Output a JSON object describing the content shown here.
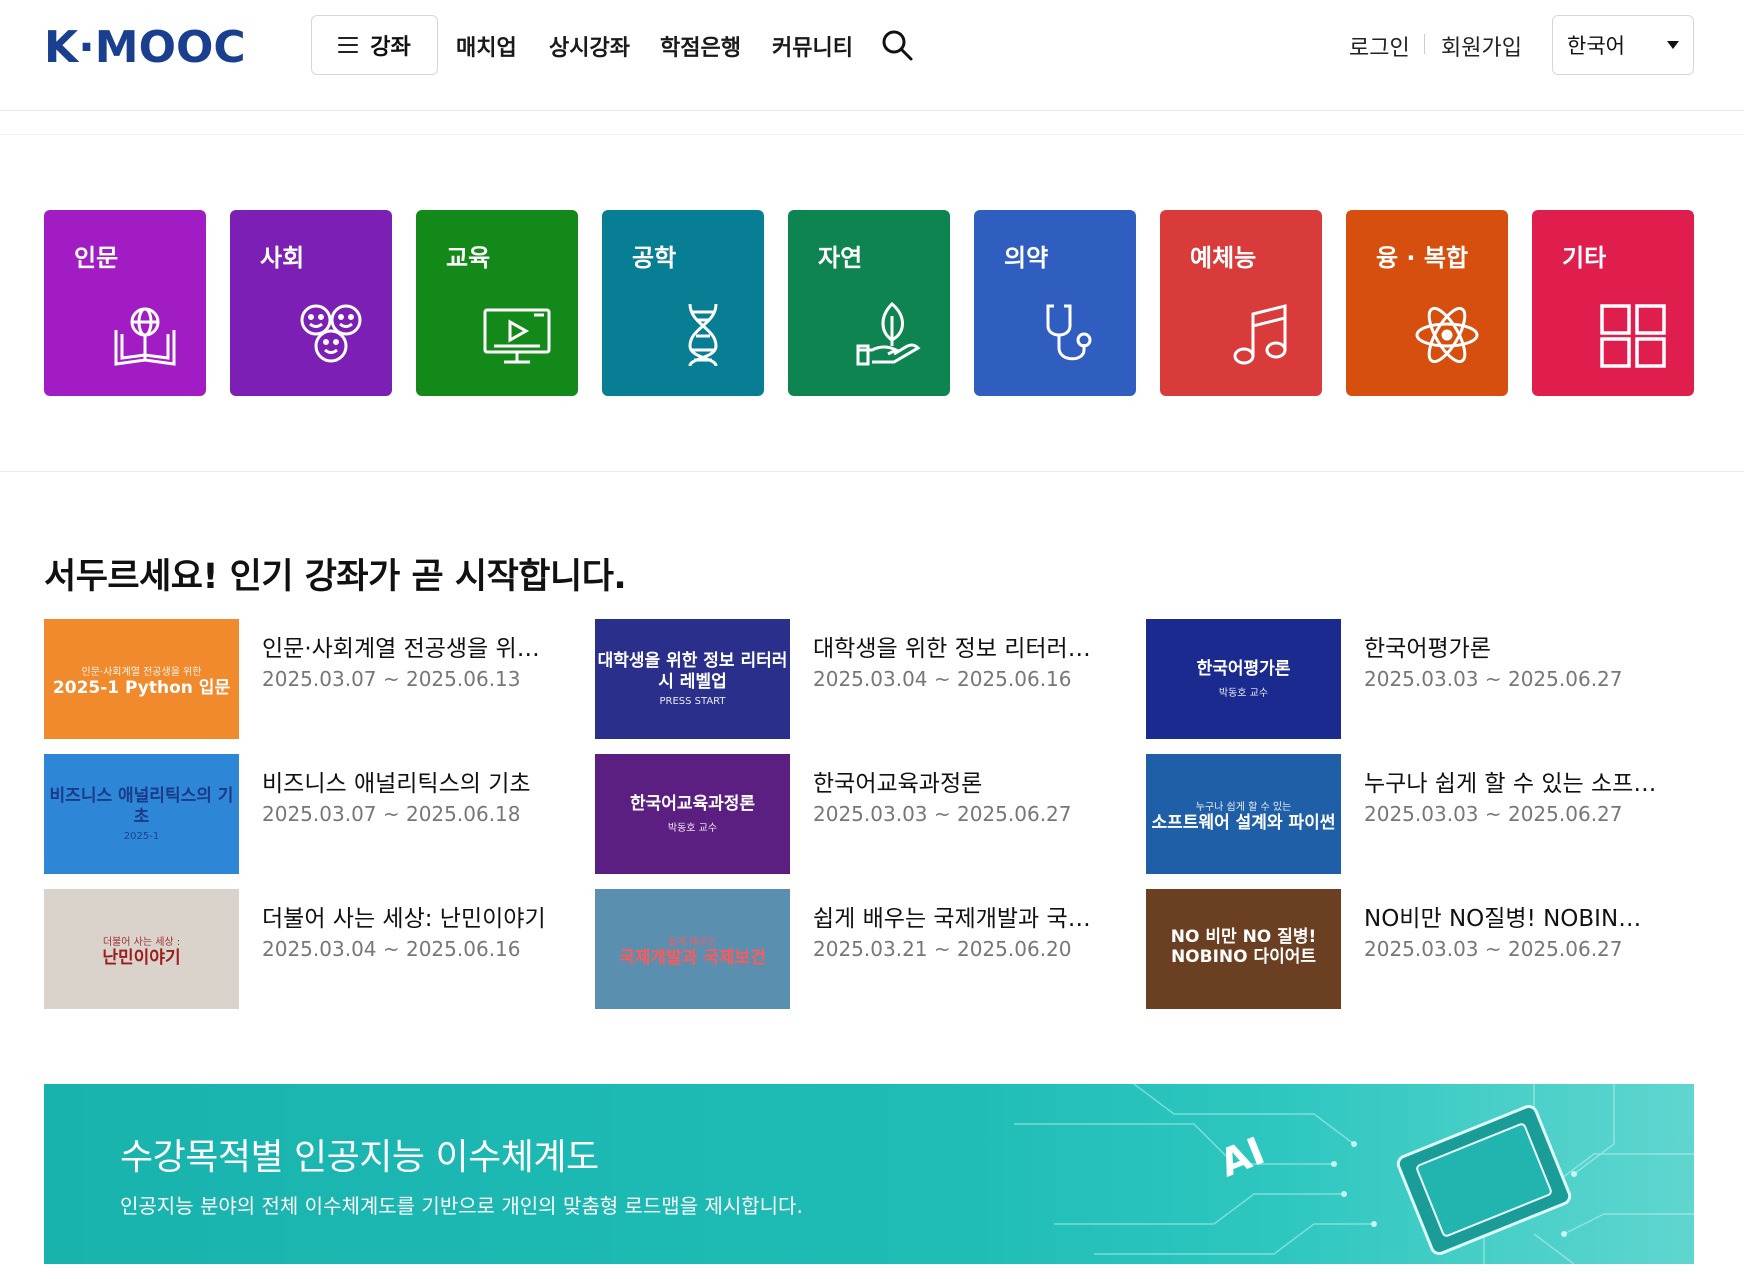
{
  "header": {
    "logo_text": "K·MOOC",
    "course_button": "강좌",
    "nav": [
      "매치업",
      "상시강좌",
      "학점은행",
      "커뮤니티"
    ],
    "login": "로그인",
    "signup": "회원가입",
    "language": "한국어"
  },
  "categories": [
    {
      "label": "인문",
      "color": "#a21cc4",
      "icon": "book-globe-icon"
    },
    {
      "label": "사회",
      "color": "#7b1fb5",
      "icon": "people-faces-icon"
    },
    {
      "label": "교육",
      "color": "#13891a",
      "icon": "video-lecture-icon"
    },
    {
      "label": "공학",
      "color": "#087e94",
      "icon": "dna-icon"
    },
    {
      "label": "자연",
      "color": "#0e8550",
      "icon": "leaf-hand-icon"
    },
    {
      "label": "의약",
      "color": "#2f5dc0",
      "icon": "stethoscope-icon"
    },
    {
      "label": "예체능",
      "color": "#d93a3a",
      "icon": "music-note-icon"
    },
    {
      "label": "융 · 복합",
      "color": "#d64f0e",
      "icon": "atom-icon"
    },
    {
      "label": "기타",
      "color": "#e01e4d",
      "icon": "grid-icon"
    }
  ],
  "popular": {
    "title": "서두르세요! 인기 강좌가 곧 시작합니다.",
    "courses": [
      {
        "title": "인문·사회계열 전공생을 위한 Python 입문",
        "date": "2025.03.07 ~ 2025.06.13",
        "thumb_main": "2025-1 Python 입문",
        "thumb_sub": "인문·사회계열 전공생을 위한",
        "thumb_bg": "#f08a2c",
        "thumb_fg": "#ffffff"
      },
      {
        "title": "대학생을 위한 정보 리터러시 레벨업",
        "date": "2025.03.04 ~ 2025.06.16",
        "thumb_main": "대학생을 위한 정보 리터러시 레벨업",
        "thumb_sub": "PRESS START",
        "thumb_bg": "#2a2f8c",
        "thumb_fg": "#ffffff"
      },
      {
        "title": "한국어평가론",
        "date": "2025.03.03 ~ 2025.06.27",
        "thumb_main": "한국어평가론",
        "thumb_sub": "박동호 교수",
        "thumb_bg": "#1a2a8f",
        "thumb_fg": "#ffffff"
      },
      {
        "title": "비즈니스 애널리틱스의 기초",
        "date": "2025.03.07 ~ 2025.06.18",
        "thumb_main": "비즈니스 애널리틱스의 기초",
        "thumb_sub": "2025-1",
        "thumb_bg": "#2e86d6",
        "thumb_fg": "#1a3b8a"
      },
      {
        "title": "한국어교육과정론",
        "date": "2025.03.03 ~ 2025.06.27",
        "thumb_main": "한국어교육과정론",
        "thumb_sub": "박동호 교수",
        "thumb_bg": "#5b1f82",
        "thumb_fg": "#ffffff"
      },
      {
        "title": "누구나 쉽게 할 수 있는 소프트웨어 설계와 파이썬",
        "date": "2025.03.03 ~ 2025.06.27",
        "thumb_main": "소프트웨어 설계와 파이썬",
        "thumb_sub": "누구나 쉽게 할 수 있는",
        "thumb_bg": "#1f5fa8",
        "thumb_fg": "#ffffff"
      },
      {
        "title": "더불어 사는 세상: 난민이야기",
        "date": "2025.03.04 ~ 2025.06.16",
        "thumb_main": "난민이야기",
        "thumb_sub": "더불어 사는 세상 :",
        "thumb_bg": "#d9d3cc",
        "thumb_fg": "#9b1c1c"
      },
      {
        "title": "쉽게 배우는 국제개발과 국제보건",
        "date": "2025.03.21 ~ 2025.06.20",
        "thumb_main": "국제개발과 국제보건",
        "thumb_sub": "쉽게 배우는",
        "thumb_bg": "#5a8fb0",
        "thumb_fg": "#ff5a5a"
      },
      {
        "title": "NO비만 NO질병! NOBINO 다이어트",
        "date": "2025.03.03 ~ 2025.06.27",
        "thumb_main": "NO 비만 NO 질병! NOBINO 다이어트",
        "thumb_sub": "",
        "thumb_bg": "#6b3f22",
        "thumb_fg": "#ffffff"
      }
    ]
  },
  "banner": {
    "title": "수강목적별 인공지능 이수체계도",
    "subtitle": "인공지능 분야의 전체 이수체계도를 기반으로 개인의 맞춤형 로드맵을 제시합니다.",
    "chip_text": "AI"
  }
}
